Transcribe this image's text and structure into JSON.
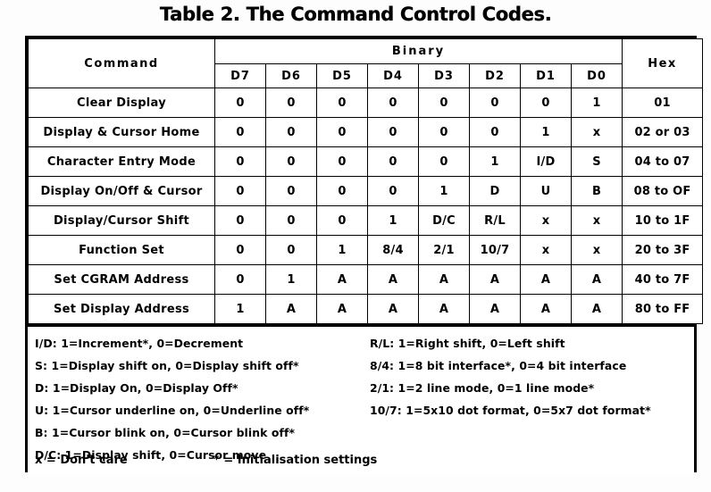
{
  "title": "Table 2. The Command Control Codes.",
  "table": {
    "headers": {
      "command": "Command",
      "binary": "Binary",
      "hex": "Hex",
      "bits": [
        "D7",
        "D6",
        "D5",
        "D4",
        "D3",
        "D2",
        "D1",
        "D0"
      ]
    },
    "rows": [
      {
        "command": "Clear Display",
        "bits": [
          "0",
          "0",
          "0",
          "0",
          "0",
          "0",
          "0",
          "1"
        ],
        "hex": "01"
      },
      {
        "command": "Display & Cursor Home",
        "bits": [
          "0",
          "0",
          "0",
          "0",
          "0",
          "0",
          "1",
          "x"
        ],
        "hex": "02 or 03"
      },
      {
        "command": "Character Entry Mode",
        "bits": [
          "0",
          "0",
          "0",
          "0",
          "0",
          "1",
          "I/D",
          "S"
        ],
        "hex": "04 to 07"
      },
      {
        "command": "Display On/Off & Cursor",
        "bits": [
          "0",
          "0",
          "0",
          "0",
          "1",
          "D",
          "U",
          "B"
        ],
        "hex": "08 to OF"
      },
      {
        "command": "Display/Cursor Shift",
        "bits": [
          "0",
          "0",
          "0",
          "1",
          "D/C",
          "R/L",
          "x",
          "x"
        ],
        "hex": "10 to 1F"
      },
      {
        "command": "Function Set",
        "bits": [
          "0",
          "0",
          "1",
          "8/4",
          "2/1",
          "10/7",
          "x",
          "x"
        ],
        "hex": "20 to 3F"
      },
      {
        "command": "Set CGRAM Address",
        "bits": [
          "0",
          "1",
          "A",
          "A",
          "A",
          "A",
          "A",
          "A"
        ],
        "hex": "40 to 7F"
      },
      {
        "command": "Set Display Address",
        "bits": [
          "1",
          "A",
          "A",
          "A",
          "A",
          "A",
          "A",
          "A"
        ],
        "hex": "80 to FF"
      }
    ]
  },
  "legend": {
    "left": [
      "I/D: 1=Increment*, 0=Decrement",
      "S: 1=Display shift on, 0=Display shift off*",
      "D: 1=Display On, 0=Display Off*",
      "U: 1=Cursor underline on, 0=Underline off*",
      "B: 1=Cursor blink on, 0=Cursor blink off*",
      "D/C: 1=Display shift, 0=Cursor move"
    ],
    "right": [
      "R/L: 1=Right shift, 0=Left shift",
      "8/4: 1=8 bit interface*, 0=4 bit interface",
      "2/1: 1=2 line mode, 0=1 line mode*",
      "10/7: 1=5x10 dot format, 0=5x7 dot format*"
    ],
    "bottom": {
      "dont_care": "x = Don't care",
      "init_settings": "* = Initialisation settings"
    }
  }
}
